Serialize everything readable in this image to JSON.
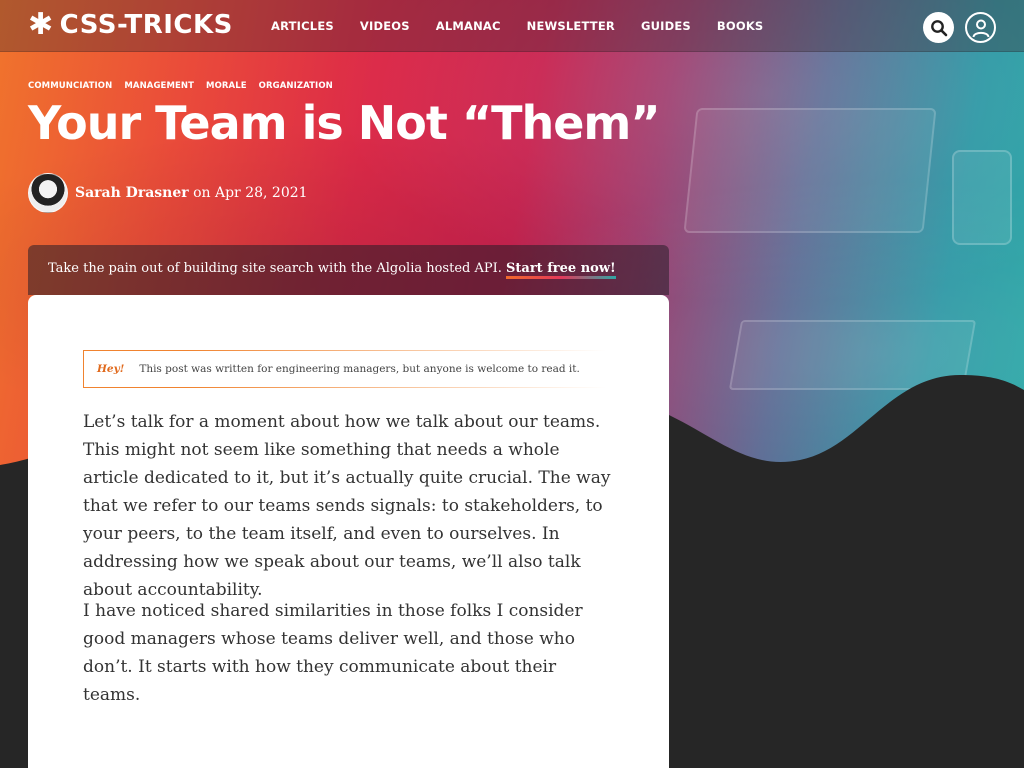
{
  "site": {
    "logo_text": "CSS-TRICKS",
    "logo_icon": "asterisk-icon"
  },
  "nav": {
    "items": [
      "ARTICLES",
      "VIDEOS",
      "ALMANAC",
      "NEWSLETTER",
      "GUIDES",
      "BOOKS"
    ]
  },
  "header_icons": {
    "search": "search-icon",
    "account": "user-icon"
  },
  "article": {
    "tags": [
      "COMMUNCIATION",
      "MANAGEMENT",
      "MORALE",
      "ORGANIZATION"
    ],
    "title": "Your Team is Not “Them”",
    "author": "Sarah Drasner",
    "date_prefix": "on",
    "date": "Apr 28, 2021",
    "note_label": "Hey!",
    "note_text": "This post was written for engineering managers, but anyone is welcome to read it.",
    "paragraphs": [
      "Let’s talk for a moment about how we talk about our teams. This might not seem like something that needs a whole article dedicated to it, but it’s actually quite crucial. The way that we refer to our teams sends signals: to stakeholders, to your peers, to the team itself, and even to ourselves. In addressing how we speak about our teams, we’ll also talk about accountability.",
      "I have noticed shared similarities in those folks I consider good managers whose teams deliver well, and those who don’t. It starts with how they communicate about their teams."
    ]
  },
  "promo": {
    "text": "Take the pain out of building site search with the Algolia hosted API. ",
    "link": "Start free now!"
  },
  "colors": {
    "accent_orange": "#f0742c",
    "accent_pink": "#dc2a48",
    "accent_teal": "#2ba8a6",
    "dark_bg": "#262626"
  }
}
